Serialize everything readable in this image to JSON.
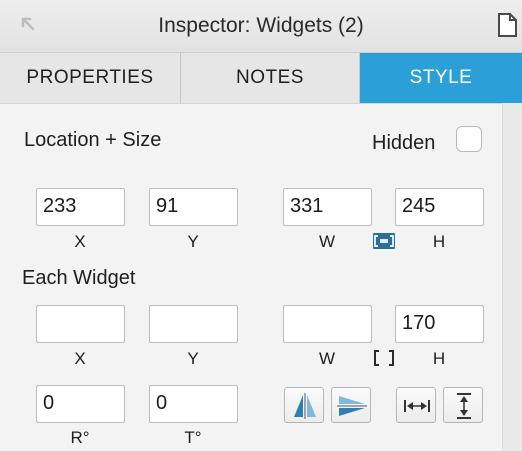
{
  "window": {
    "title": "Inspector: Widgets (2)"
  },
  "tabs": [
    {
      "label": "PROPERTIES",
      "active": false
    },
    {
      "label": "NOTES",
      "active": false
    },
    {
      "label": "STYLE",
      "active": true
    }
  ],
  "accent_color": "#2a9fd8",
  "location_size": {
    "heading": "Location + Size",
    "hidden_label": "Hidden",
    "hidden_checked": false,
    "x": "233",
    "y": "91",
    "w": "331",
    "h": "245",
    "x_label": "X",
    "y_label": "Y",
    "w_label": "W",
    "h_label": "H",
    "aspect_lock": "locked"
  },
  "each_widget": {
    "heading": "Each Widget",
    "x": "",
    "y": "",
    "w": "",
    "h": "170",
    "x_label": "X",
    "y_label": "Y",
    "w_label": "W",
    "h_label": "H",
    "aspect_lock": "unlocked",
    "r": "0",
    "t": "0",
    "r_label": "R°",
    "t_label": "T°"
  },
  "icons": {
    "back": "back-arrow-icon",
    "document": "document-icon",
    "flip_horizontal": "flip-horizontal-icon",
    "flip_vertical": "flip-vertical-icon",
    "distribute_horizontal": "distribute-horizontal-icon",
    "distribute_vertical": "distribute-vertical-icon"
  }
}
